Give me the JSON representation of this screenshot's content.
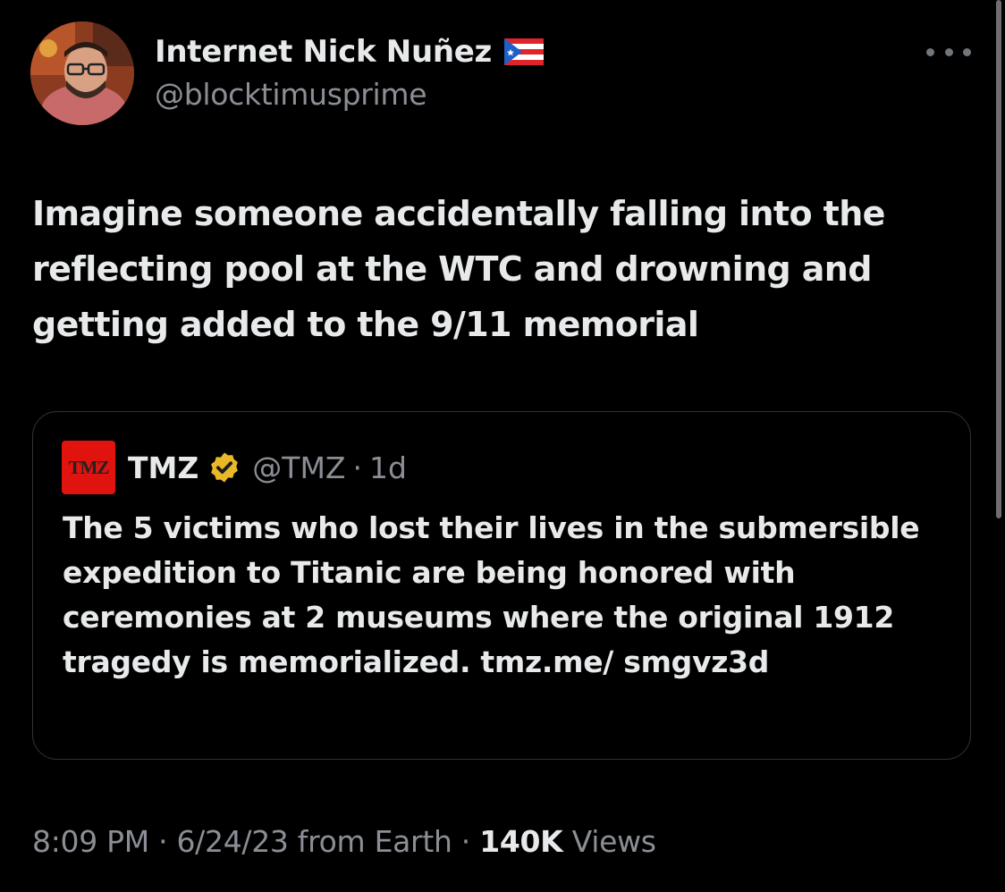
{
  "tweet": {
    "author": {
      "display_name": "Internet Nick Nuñez",
      "handle": "@blocktimusprime",
      "flag_icon": "puerto-rico-flag-icon"
    },
    "text": "Imagine someone accidentally falling into the reflecting pool at the WTC and drowning and getting added to the 9/11 memorial",
    "quoted_tweet": {
      "logo_text": "TMZ",
      "display_name": "TMZ",
      "verified_icon": "gold-verified-badge-icon",
      "handle": "@TMZ",
      "separator": "·",
      "time": "1d",
      "text": "The 5 victims who lost their lives in the submersible expedition to Titanic are being honored with ceremonies at 2 museums where the original 1912 tragedy is memorialized. tmz.me/ smgvz3d"
    },
    "meta": {
      "time": "8:09 PM",
      "separator": "·",
      "date": "6/24/23 from Earth",
      "views_count": "140K",
      "views_label": "Views"
    }
  },
  "colors": {
    "background": "#000000",
    "primary_text": "#e7e9ea",
    "secondary_text": "#8b8f95",
    "border": "#2f3336",
    "tmz_red": "#e0130e",
    "verified_gold": "#e8b829"
  }
}
